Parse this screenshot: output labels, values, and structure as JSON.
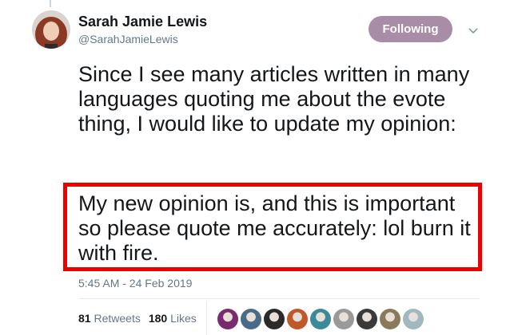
{
  "author": {
    "name": "Sarah Jamie Lewis",
    "handle": "@SarahJamieLewis"
  },
  "follow_button": {
    "label": "Following",
    "color": "#a98ca5"
  },
  "menu": {
    "icon": "chevron-down-icon"
  },
  "tweet": {
    "text_part1": "Since I see many articles written in many languages quoting me about the evote thing, I would like to update my opinion:",
    "text_part2": "My new opinion is, and this is important so please quote me accurately: lol burn it with fire.",
    "highlight_color": "#ee0000",
    "timestamp": "5:45 AM - 24 Feb 2019"
  },
  "stats": {
    "retweets_count": "81",
    "retweets_label": "Retweets",
    "likes_count": "180",
    "likes_label": "Likes"
  },
  "likers": [
    {
      "name": "liker-avatar",
      "color": "#7a2a6e"
    },
    {
      "name": "liker-avatar",
      "color": "#4a6a8a"
    },
    {
      "name": "liker-avatar",
      "color": "#2a2a2a"
    },
    {
      "name": "liker-avatar",
      "color": "#c0582a"
    },
    {
      "name": "liker-avatar",
      "color": "#3a8a9a"
    },
    {
      "name": "liker-avatar",
      "color": "#9a9a9a"
    },
    {
      "name": "liker-avatar",
      "color": "#3a3a3a"
    },
    {
      "name": "liker-avatar",
      "color": "#8a7a5a"
    },
    {
      "name": "liker-avatar",
      "color": "#a0b8c0"
    }
  ]
}
